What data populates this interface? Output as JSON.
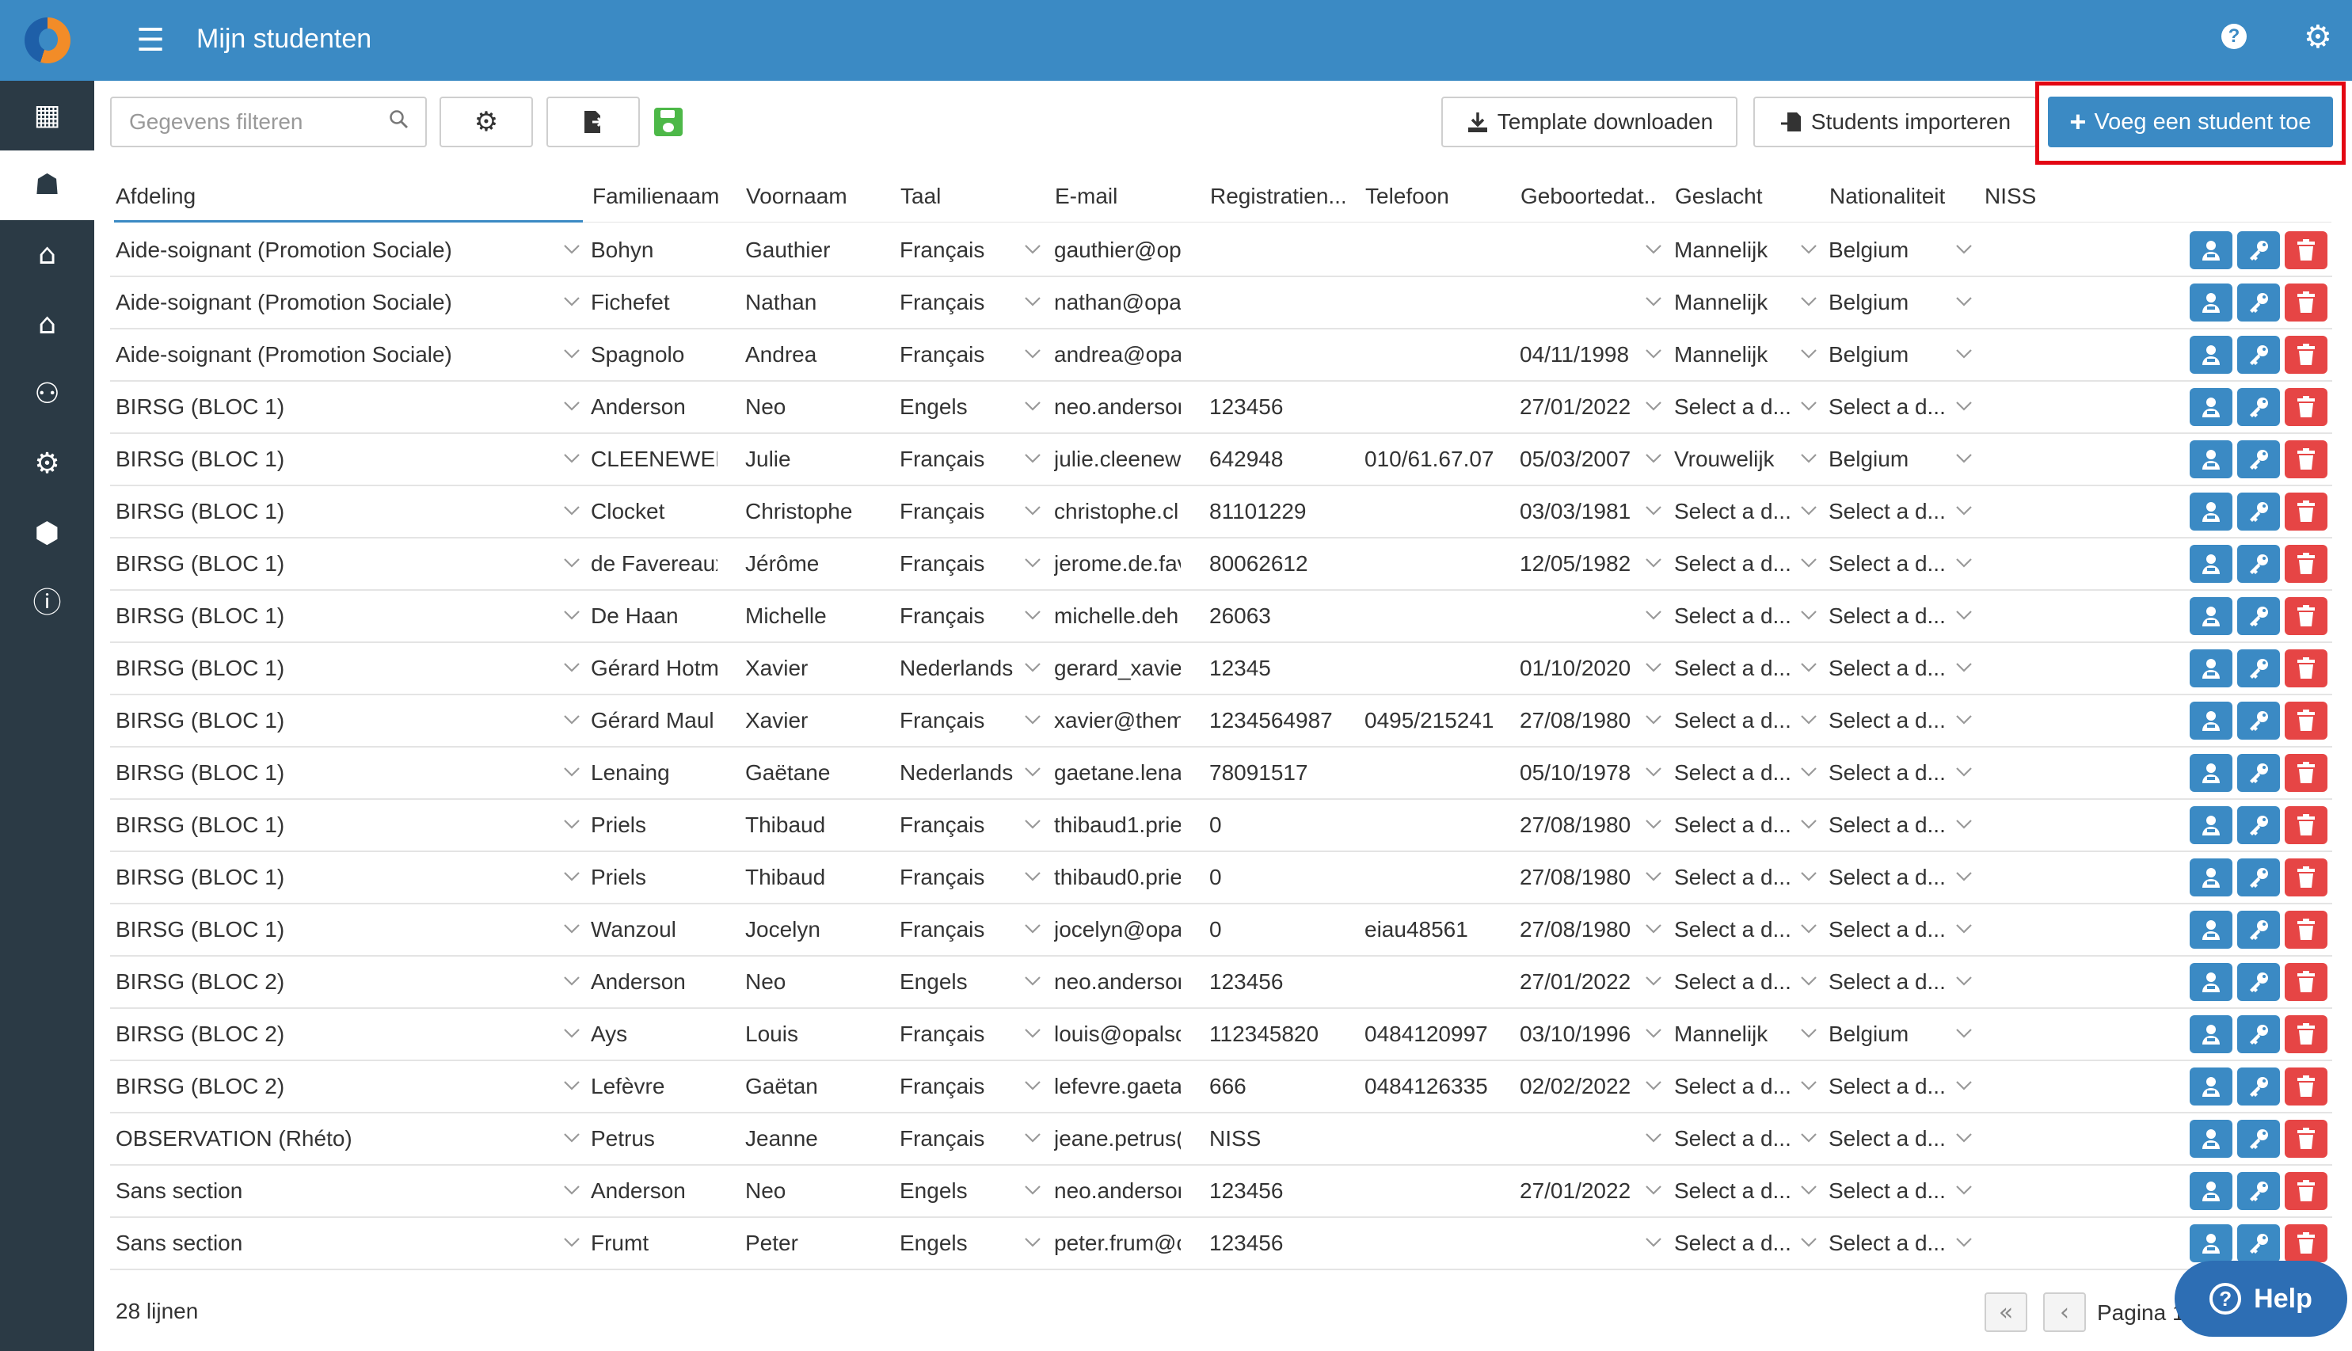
{
  "header": {
    "title": "Mijn studenten"
  },
  "sidebar": {
    "items": [
      {
        "icon": "calendar-icon",
        "glyph": "▦"
      },
      {
        "icon": "student-icon",
        "glyph": "☗"
      },
      {
        "icon": "graduation-cap-icon",
        "glyph": "⌂"
      },
      {
        "icon": "home-icon",
        "glyph": "⌂"
      },
      {
        "icon": "people-icon",
        "glyph": "⚇"
      },
      {
        "icon": "cogs-icon",
        "glyph": "⚙"
      },
      {
        "icon": "tags-icon",
        "glyph": "⬢"
      },
      {
        "icon": "info-icon",
        "glyph": "ⓘ"
      }
    ]
  },
  "toolbar": {
    "filter_placeholder": "Gegevens filteren",
    "template_label": "Template downloaden",
    "import_label": "Students importeren",
    "add_label": "Voeg een student toe"
  },
  "table": {
    "columns": [
      "Afdeling",
      "Familienaam",
      "Voornaam",
      "Taal",
      "E-mail",
      "Registratien...",
      "Telefoon",
      "Geboortedat...",
      "Geslacht",
      "Nationaliteit",
      "NISS"
    ],
    "rows": [
      [
        "Aide-soignant (Promotion Sociale)",
        "Bohyn",
        "Gauthier",
        "Français",
        "gauthier@op",
        "",
        "",
        "",
        "Mannelijk",
        "Belgium"
      ],
      [
        "Aide-soignant (Promotion Sociale)",
        "Fichefet",
        "Nathan",
        "Français",
        "nathan@opal",
        "",
        "",
        "",
        "Mannelijk",
        "Belgium"
      ],
      [
        "Aide-soignant (Promotion Sociale)",
        "Spagnolo",
        "Andrea",
        "Français",
        "andrea@opal",
        "",
        "",
        "04/11/1998",
        "Mannelijk",
        "Belgium"
      ],
      [
        "BIRSG (BLOC 1)",
        "Anderson",
        "Neo",
        "Engels",
        "neo.andersor",
        "123456",
        "",
        "27/01/2022",
        "Select a d...",
        "Select a d..."
      ],
      [
        "BIRSG (BLOC 1)",
        "CLEENEWER",
        "Julie",
        "Français",
        "julie.cleenew",
        "642948",
        "010/61.67.07",
        "05/03/2007",
        "Vrouwelijk",
        "Belgium"
      ],
      [
        "BIRSG (BLOC 1)",
        "Clocket",
        "Christophe",
        "Français",
        "christophe.cl",
        "81101229",
        "",
        "03/03/1981",
        "Select a d...",
        "Select a d..."
      ],
      [
        "BIRSG (BLOC 1)",
        "de Favereaux",
        "Jérôme",
        "Français",
        "jerome.de.fav",
        "80062612",
        "",
        "12/05/1982",
        "Select a d...",
        "Select a d..."
      ],
      [
        "BIRSG (BLOC 1)",
        "De Haan",
        "Michelle",
        "Français",
        "michelle.deh",
        "26063",
        "",
        "",
        "Select a d...",
        "Select a d..."
      ],
      [
        "BIRSG (BLOC 1)",
        "Gérard Hotm",
        "Xavier",
        "Nederlands",
        "gerard_xavier",
        "12345",
        "",
        "01/10/2020",
        "Select a d...",
        "Select a d..."
      ],
      [
        "BIRSG (BLOC 1)",
        "Gérard Maul",
        "Xavier",
        "Français",
        "xavier@them",
        "1234564987",
        "0495/215241",
        "27/08/1980",
        "Select a d...",
        "Select a d..."
      ],
      [
        "BIRSG (BLOC 1)",
        "Lenaing",
        "Gaëtane",
        "Nederlands",
        "gaetane.lena",
        "78091517",
        "",
        "05/10/1978",
        "Select a d...",
        "Select a d..."
      ],
      [
        "BIRSG (BLOC 1)",
        "Priels",
        "Thibaud",
        "Français",
        "thibaud1.prie",
        "0",
        "",
        "27/08/1980",
        "Select a d...",
        "Select a d..."
      ],
      [
        "BIRSG (BLOC 1)",
        "Priels",
        "Thibaud",
        "Français",
        "thibaud0.prie",
        "0",
        "",
        "27/08/1980",
        "Select a d...",
        "Select a d..."
      ],
      [
        "BIRSG (BLOC 1)",
        "Wanzoul",
        "Jocelyn",
        "Français",
        "jocelyn@opa",
        "0",
        "eiau48561",
        "27/08/1980",
        "Select a d...",
        "Select a d..."
      ],
      [
        "BIRSG (BLOC 2)",
        "Anderson",
        "Neo",
        "Engels",
        "neo.andersor",
        "123456",
        "",
        "27/01/2022",
        "Select a d...",
        "Select a d..."
      ],
      [
        "BIRSG (BLOC 2)",
        "Ays",
        "Louis",
        "Français",
        "louis@opalsc",
        "112345820",
        "0484120997",
        "03/10/1996",
        "Mannelijk",
        "Belgium"
      ],
      [
        "BIRSG (BLOC 2)",
        "Lefèvre",
        "Gaëtan",
        "Français",
        "lefevre.gaeta",
        "666",
        "0484126335",
        "02/02/2022",
        "Select a d...",
        "Select a d..."
      ],
      [
        "OBSERVATION (Rhéto)",
        "Petrus",
        "Jeanne",
        "Français",
        "jeane.petrus(",
        "NISS",
        "",
        "",
        "Select a d...",
        "Select a d..."
      ],
      [
        "Sans section",
        "Anderson",
        "Neo",
        "Engels",
        "neo.andersor",
        "123456",
        "",
        "27/01/2022",
        "Select a d...",
        "Select a d..."
      ],
      [
        "Sans section",
        "Frumt",
        "Peter",
        "Engels",
        "peter.frum@c",
        "123456",
        "",
        "",
        "Select a d...",
        "Select a d..."
      ]
    ]
  },
  "footer": {
    "count_label": "28 lijnen",
    "page_label": "Pagina 1"
  },
  "help": {
    "label": "Help"
  },
  "colors": {
    "primary": "#3b8ac4",
    "sidebar": "#2b3a45",
    "danger": "#e64545",
    "highlight": "#e30613",
    "save": "#4db848"
  }
}
